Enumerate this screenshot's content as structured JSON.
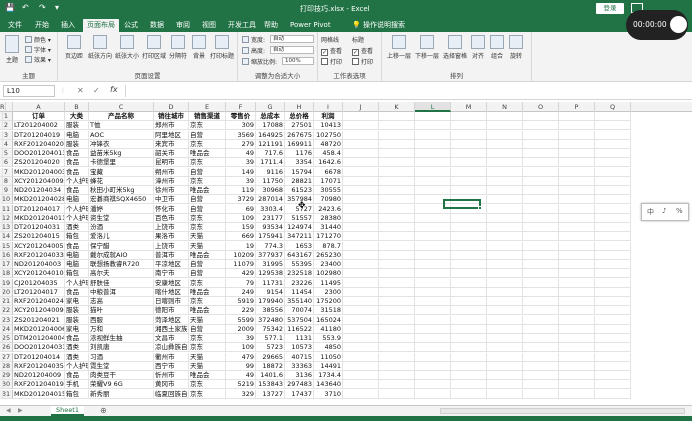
{
  "titlebar": {
    "quick_access": [
      "💾",
      "↶",
      "↷",
      "▾"
    ],
    "title": "打印技巧.xlsx - Excel",
    "login": "登录"
  },
  "recorder": {
    "time": "00:00:00"
  },
  "menu": {
    "tabs": [
      "文件",
      "开始",
      "插入",
      "页面布局",
      "公式",
      "数据",
      "审阅",
      "视图",
      "开发工具",
      "帮助",
      "Power Pivot"
    ],
    "active": "页面布局",
    "tell_me": "操作说明搜索"
  },
  "ribbon": {
    "theme": {
      "main": "主题",
      "colors": "颜色 ▾",
      "fonts": "字体 ▾",
      "effects": "效果 ▾",
      "label": "主题"
    },
    "page_setup": {
      "buttons": [
        "页边距",
        "纸张方向",
        "纸张大小",
        "打印区域",
        "分隔符",
        "背景",
        "打印标题"
      ],
      "label": "页面设置"
    },
    "scale": {
      "width_label": "宽度:",
      "width_value": "自动",
      "height_label": "高度:",
      "height_value": "自动",
      "scale_label": "缩放比例:",
      "scale_value": "100%",
      "label": "调整为合适大小"
    },
    "sheet_options": {
      "gridlines": "网格线",
      "headings": "标题",
      "view": "查看",
      "print": "打印",
      "label": "工作表选项"
    },
    "arrange": {
      "buttons": [
        "上移一层",
        "下移一层",
        "选择窗格",
        "对齐",
        "组合",
        "旋转"
      ],
      "label": "排列"
    }
  },
  "formula_bar": {
    "name_box": "L10",
    "cancel": "✕",
    "confirm": "✓",
    "fx": "fx",
    "value": ""
  },
  "grid": {
    "columns": [
      "A",
      "B",
      "C",
      "D",
      "E",
      "F",
      "G",
      "H",
      "I",
      "J",
      "K",
      "L",
      "M",
      "N",
      "O",
      "P",
      "Q",
      "R"
    ],
    "selected_column": "L",
    "headers": [
      "订单",
      "大类",
      "产品名称",
      "销往城市",
      "销售渠道",
      "零售价",
      "总成本",
      "总价格",
      "利润"
    ],
    "rows": [
      [
        "LT201204002",
        "服装",
        "T恤",
        "郑州市",
        "京东",
        "309",
        "17088",
        "27501",
        "10413"
      ],
      [
        "DT201204019",
        "电脑",
        "AOC",
        "阿里地区",
        "自营",
        "3569",
        "164925",
        "267675",
        "102750"
      ],
      [
        "RXF201204020",
        "服装",
        "冲锋衣",
        "来宾市",
        "京东",
        "279",
        "121191",
        "169911",
        "48720"
      ],
      [
        "DOO201204013",
        "食品",
        "益苗米5kg",
        "韶关市",
        "唯品会",
        "49",
        "717.6",
        "1176",
        "458.4"
      ],
      [
        "ZS201204020",
        "食品",
        "卡德堡里",
        "昆明市",
        "京东",
        "39",
        "1711.4",
        "3354",
        "1642.6"
      ],
      [
        "MKD201204003",
        "食品",
        "宝藏",
        "朔州市",
        "自营",
        "149",
        "9116",
        "15794",
        "6678"
      ],
      [
        "XCY201204009",
        "个人护理",
        "蜂花",
        "漳州市",
        "京东",
        "39",
        "11750",
        "28821",
        "17071"
      ],
      [
        "ND201204034",
        "食品",
        "秋田小町米5kg",
        "徐州市",
        "唯品会",
        "119",
        "30968",
        "61523",
        "30555"
      ],
      [
        "MKD201204028",
        "电脑",
        "宏碁商祺SQX4650",
        "中卫市",
        "自营",
        "3729",
        "287014",
        "357984",
        "70980"
      ],
      [
        "DT201204017",
        "个人护理",
        "潘婷",
        "怀化市",
        "自营",
        "69",
        "3303.4",
        "5727",
        "2423.6"
      ],
      [
        "MKD201204011",
        "个人护理",
        "资生堂",
        "百色市",
        "京东",
        "109",
        "23177",
        "51557",
        "28380"
      ],
      [
        "DT201204031",
        "酒类",
        "汾酒",
        "上饶市",
        "京东",
        "159",
        "93534",
        "124974",
        "31440"
      ],
      [
        "ZS201204015",
        "箱包",
        "爱洛儿",
        "果洛市",
        "天猫",
        "669",
        "175941",
        "347211",
        "171270"
      ],
      [
        "XCY201204005",
        "食品",
        "保宁醋",
        "上饶市",
        "天猫",
        "19",
        "774.3",
        "1653",
        "878.7"
      ],
      [
        "RXF201204033",
        "电脑",
        "戴尔成就AIO",
        "普洱市",
        "唯品会",
        "10209",
        "377937",
        "643167",
        "265230"
      ],
      [
        "ND201204003",
        "电脑",
        "联想扬教睿R720",
        "平凉地区",
        "自营",
        "11079",
        "31995",
        "55395",
        "23400"
      ],
      [
        "XCY201204010",
        "箱包",
        "高尔夫",
        "南宁市",
        "自营",
        "429",
        "129538",
        "232518",
        "102980"
      ],
      [
        "CJ201204035",
        "个人护理",
        "舒肤佳",
        "安康地区",
        "京东",
        "79",
        "11731",
        "23226",
        "11495"
      ],
      [
        "LT201204017",
        "食品",
        "中粮普洱",
        "喀什地区",
        "唯品会",
        "249",
        "9154",
        "11454",
        "2300"
      ],
      [
        "RXF201204024",
        "家电",
        "志高",
        "日喀则市",
        "京东",
        "5919",
        "179940",
        "355140",
        "175200"
      ],
      [
        "XCY201204009",
        "服装",
        "猫叶",
        "德阳市",
        "唯品会",
        "229",
        "38556",
        "70074",
        "31518"
      ],
      [
        "ZS201204021",
        "服装",
        "西服",
        "菏泽地区",
        "天猫",
        "5599",
        "372480",
        "537504",
        "165024"
      ],
      [
        "MKD201204006",
        "家电",
        "万和",
        "湘西土家族自",
        "自营",
        "2009",
        "75342",
        "116522",
        "41180"
      ],
      [
        "DTM201204004",
        "食品",
        "浓视鲜生抽",
        "文昌市",
        "京东",
        "39",
        "577.1",
        "1131",
        "553.9"
      ],
      [
        "DOO201204033",
        "酒类",
        "刘凯唐",
        "凉山彝族自",
        "京东",
        "109",
        "5723",
        "10573",
        "4850"
      ],
      [
        "DT201204014",
        "酒类",
        "习酒",
        "衢州市",
        "天猫",
        "479",
        "29665",
        "40715",
        "11050"
      ],
      [
        "RXF201204035",
        "个人护理",
        "霓生堂",
        "西宁市",
        "天猫",
        "99",
        "18872",
        "33363",
        "14491"
      ],
      [
        "ND201204009",
        "食品",
        "肉类豆干",
        "忻州市",
        "唯品会",
        "49",
        "1401.6",
        "3136",
        "1734.4"
      ],
      [
        "RXF201204019",
        "手机",
        "荣耀V9 6G",
        "黄冈市",
        "京东",
        "5219",
        "153843",
        "297483",
        "143640"
      ],
      [
        "MKD201204015",
        "箱包",
        "新秀丽",
        "临夏回族自",
        "京东",
        "329",
        "13727",
        "17437",
        "3710"
      ]
    ]
  },
  "popup": {
    "items": [
      "中",
      "♪",
      "%"
    ]
  },
  "sheets": {
    "tabs": [
      "Sheet1"
    ],
    "add": "⊕",
    "nav": [
      "◀",
      "▶"
    ]
  }
}
